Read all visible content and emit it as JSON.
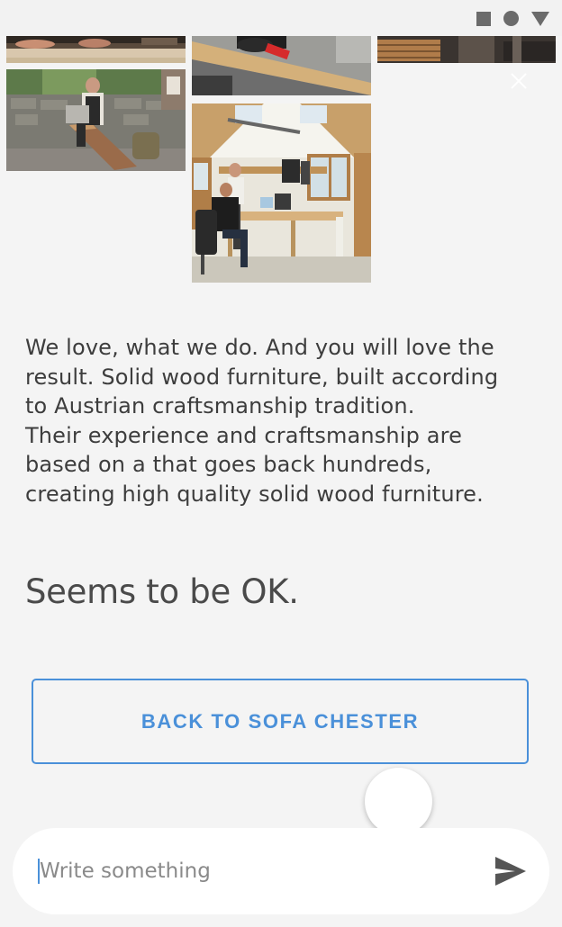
{
  "status_bar": {
    "icons": [
      "stop-square-icon",
      "record-circle-icon",
      "signal-triangle-icon"
    ]
  },
  "gallery": {
    "images": [
      {
        "name": "woodworking-hands-photo"
      },
      {
        "name": "wood-plank-saw-photo"
      },
      {
        "name": "lumber-stack-photo"
      },
      {
        "name": "craftsman-planing-log-photo"
      },
      {
        "name": "design-office-photo"
      }
    ],
    "close_icon": "close-icon"
  },
  "description": "We love, what we do. And you will love the\nresult. Solid wood furniture, built according\nto Austrian craftsmanship tradition.\nTheir experience and craftsmanship are\nbased on a that goes back hundreds,\ncreating high quality solid wood furniture.",
  "status_message": "Seems to be OK.",
  "back_button": {
    "label": "BACK TO SOFA CHESTER"
  },
  "composer": {
    "placeholder": "Write something",
    "value": "",
    "send_icon": "send-icon"
  },
  "colors": {
    "accent": "#4a90d9",
    "background": "#f4f4f4",
    "text": "#3d3d3d"
  }
}
